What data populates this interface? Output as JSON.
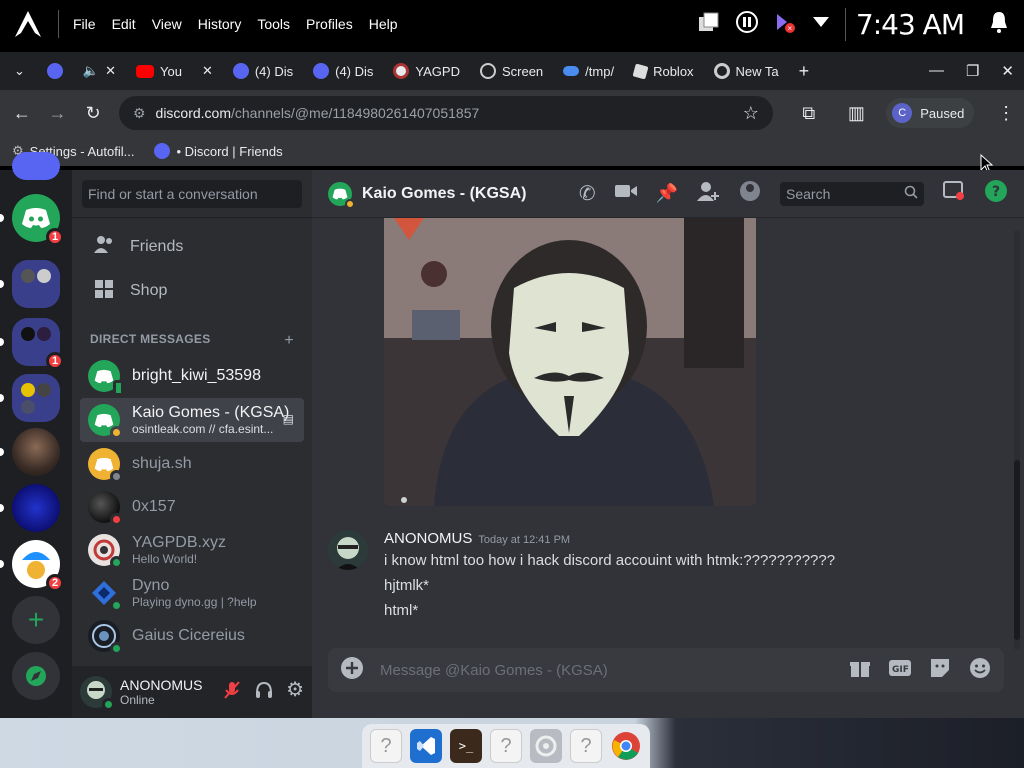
{
  "os": {
    "menu": [
      "File",
      "Edit",
      "View",
      "History",
      "Tools",
      "Profiles",
      "Help"
    ],
    "clock": "7:43 AM"
  },
  "browser": {
    "tabs": [
      {
        "label": "",
        "icon": "discord-badge-icon"
      },
      {
        "label": "",
        "icon": "speaker-icon"
      },
      {
        "label": "You",
        "icon": "youtube-icon"
      },
      {
        "label": "(4) Dis",
        "icon": "discord-badge-icon"
      },
      {
        "label": "(4) Dis",
        "icon": "discord-badge-icon"
      },
      {
        "label": "YAGPD",
        "icon": "yagpdb-icon"
      },
      {
        "label": "Screen",
        "icon": "screen-icon"
      },
      {
        "label": "/tmp/",
        "icon": "cloud-icon"
      },
      {
        "label": "Roblox",
        "icon": "roblox-icon"
      },
      {
        "label": "New Ta",
        "icon": "chrome-icon"
      }
    ],
    "url_host": "discord.com",
    "url_path": "/channels/@me/1184980261407051857",
    "profile_initial": "C",
    "profile_status": "Paused",
    "bookmarks": [
      {
        "label": "Settings - Autofil...",
        "icon": "gear-icon"
      },
      {
        "label": "• Discord | Friends",
        "icon": "discord-badge-icon"
      }
    ]
  },
  "guilds": [
    {
      "badge": "1"
    },
    {
      "badge": ""
    },
    {
      "badge": "1"
    },
    {
      "badge": ""
    },
    {
      "badge": ""
    },
    {
      "badge": ""
    },
    {
      "badge": "2"
    }
  ],
  "sidebar": {
    "search_placeholder": "Find or start a conversation",
    "friends_label": "Friends",
    "shop_label": "Shop",
    "dm_header": "DIRECT MESSAGES",
    "dms": [
      {
        "name": "bright_kiwi_53598",
        "sub": "",
        "status": "mobile"
      },
      {
        "name": "Kaio Gomes - (KGSA)",
        "sub": "osintleak.com // cfa.esint...",
        "status": "idle"
      },
      {
        "name": "shuja.sh",
        "sub": "",
        "status": "offline"
      },
      {
        "name": "0x157",
        "sub": "",
        "status": "dnd"
      },
      {
        "name": "YAGPDB.xyz",
        "sub": "Hello World!",
        "status": "online"
      },
      {
        "name": "Dyno",
        "sub": "Playing dyno.gg | ?help",
        "status": "online"
      },
      {
        "name": "Gaius Cicereius",
        "sub": "",
        "status": "online"
      }
    ]
  },
  "user": {
    "name": "ANONOMUS",
    "status": "Online"
  },
  "chat": {
    "title": "Kaio Gomes - (KGSA)",
    "search_placeholder": "Search",
    "message": {
      "author": "ANONOMUS",
      "timestamp": "Today at 12:41 PM",
      "lines": [
        "i know html too how i hack discord accouint with htmk:???????????",
        "hjtmlk*",
        "html*"
      ]
    },
    "composer_placeholder": "Message @Kaio Gomes - (KGSA)"
  },
  "colors": {
    "blurple": "#5865f2",
    "green": "#23a55a",
    "red": "#f23f43",
    "idle": "#f0b232"
  }
}
